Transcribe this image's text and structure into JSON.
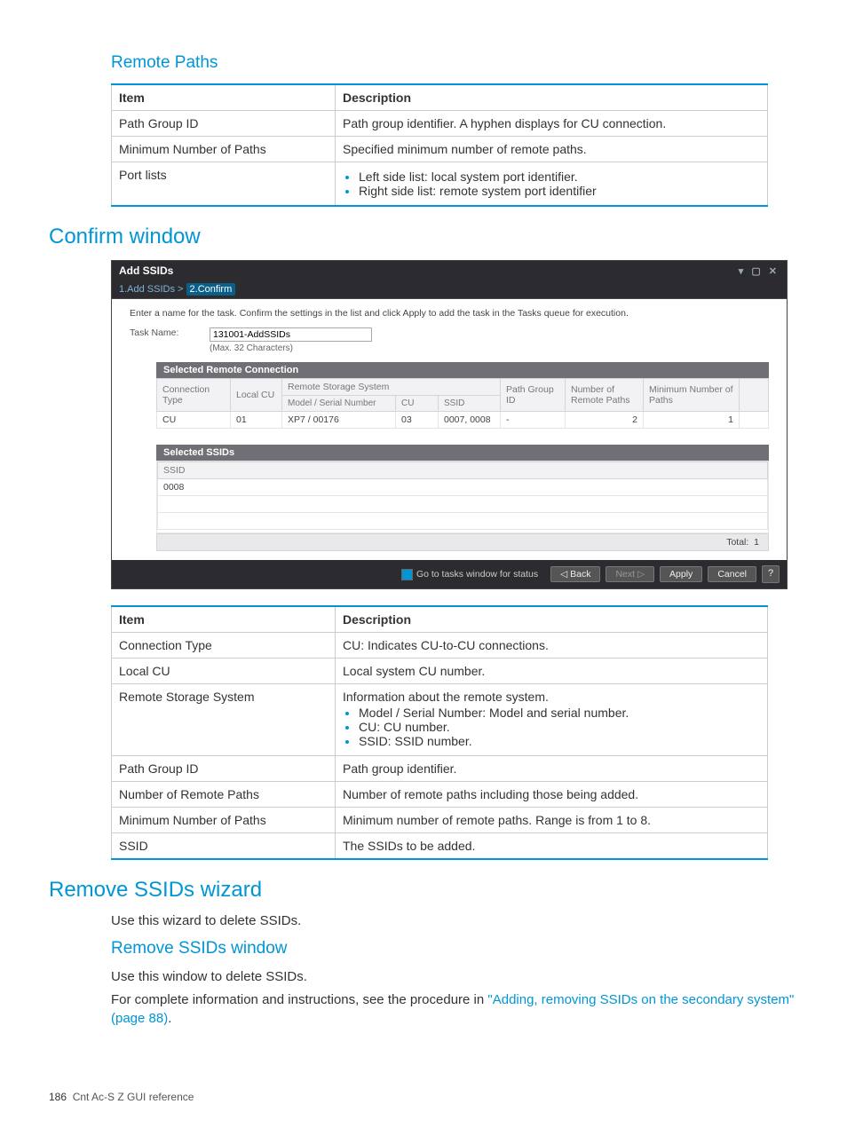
{
  "section1_title": "Remote Paths",
  "table1": {
    "headers": [
      "Item",
      "Description"
    ],
    "rows": [
      {
        "item": "Path Group ID",
        "desc": "Path group identifier. A hyphen displays for CU connection."
      },
      {
        "item": "Minimum Number of Paths",
        "desc": "Specified minimum number of remote paths."
      },
      {
        "item": "Port lists",
        "desc_list": [
          "Left side list: local system port identifier.",
          "Right side list: remote system port identifier"
        ]
      }
    ]
  },
  "section2_title": "Confirm window",
  "shot": {
    "title": "Add SSIDs",
    "breadcrumb_step1": "1.Add SSIDs",
    "breadcrumb_sep": ">",
    "breadcrumb_step2": "2.Confirm",
    "instruction": "Enter a name for the task. Confirm the settings in the list and click Apply to add the task in the Tasks queue for execution.",
    "task_label": "Task Name:",
    "task_value": "131001-AddSSIDs",
    "task_hint": "(Max. 32 Characters)",
    "panel1_title": "Selected Remote Connection",
    "p1_headers": {
      "conn_type": "Connection Type",
      "local_cu": "Local CU",
      "rss_group": "Remote Storage System",
      "model_serial": "Model / Serial Number",
      "cu": "CU",
      "ssid": "SSID",
      "pgid": "Path Group ID",
      "nrp": "Number of Remote Paths",
      "mnp": "Minimum Number of Paths"
    },
    "p1_row": {
      "conn_type": "CU",
      "local_cu": "01",
      "model_serial": "XP7 / 00176",
      "cu": "03",
      "ssid": "0007, 0008",
      "pgid": "-",
      "nrp": "2",
      "mnp": "1"
    },
    "panel2_title": "Selected SSIDs",
    "p2_header": "SSID",
    "p2_row": "0008",
    "total_label": "Total:",
    "total_value": "1",
    "footer": {
      "checkbox": "Go to tasks window for status",
      "back": "Back",
      "next": "Next",
      "apply": "Apply",
      "cancel": "Cancel",
      "help": "?"
    }
  },
  "table2": {
    "headers": [
      "Item",
      "Description"
    ],
    "rows": [
      {
        "item": "Connection Type",
        "desc": "CU: Indicates CU-to-CU connections."
      },
      {
        "item": "Local CU",
        "desc": "Local system CU number."
      },
      {
        "item": "Remote Storage System",
        "desc_lead": "Information about the remote system.",
        "desc_list": [
          "Model / Serial Number: Model and serial number.",
          "CU: CU number.",
          "SSID: SSID number."
        ]
      },
      {
        "item": "Path Group ID",
        "desc": "Path group identifier."
      },
      {
        "item": "Number of Remote Paths",
        "desc": "Number of remote paths including those being added."
      },
      {
        "item": "Minimum Number of Paths",
        "desc": "Minimum number of remote paths. Range is from 1 to 8."
      },
      {
        "item": "SSID",
        "desc": "The SSIDs to be added."
      }
    ]
  },
  "section3_title": "Remove SSIDs wizard",
  "section3_body": "Use this wizard to delete SSIDs.",
  "section4_title": "Remove SSIDs window",
  "section4_body1": "Use this window to delete SSIDs.",
  "section4_body2a": "For complete information and instructions, see the procedure in ",
  "section4_link": "\"Adding, removing SSIDs on the secondary system\" (page 88)",
  "section4_body2b": ".",
  "footer_page": "186",
  "footer_text": "Cnt Ac-S Z GUI reference"
}
